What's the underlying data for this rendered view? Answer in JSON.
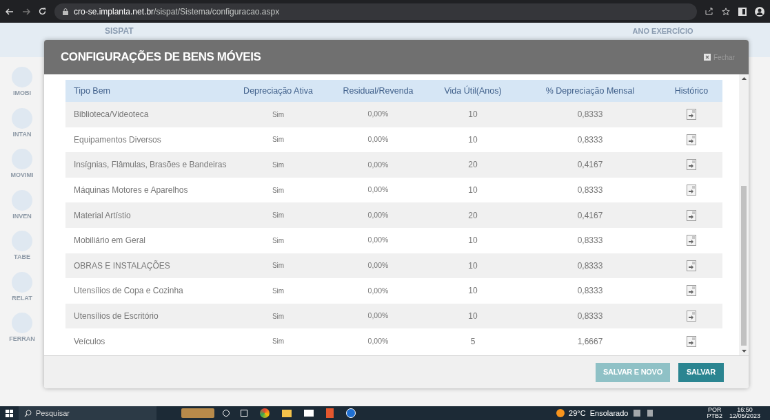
{
  "browser": {
    "url_host": "cro-se.implanta.net.br",
    "url_path": "/sispat/Sistema/configuracao.aspx"
  },
  "background": {
    "app_name": "SISPAT",
    "year_label": "ANO EXERCÍCIO",
    "sidebar": [
      "IMOBI",
      "INTAN",
      "MOVIMI",
      "INVEN",
      "TABE",
      "RELAT",
      "FERRAN"
    ]
  },
  "dialog": {
    "title": "CONFIGURAÇÕES DE BENS MÓVEIS",
    "close_label": "Fechar",
    "table": {
      "columns": [
        "Tipo Bem",
        "Depreciação Ativa",
        "Residual/Revenda",
        "Vida Útil(Anos)",
        "% Depreciação Mensal",
        "Histórico"
      ],
      "rows": [
        {
          "tipo": "Biblioteca/Videoteca",
          "ativa": "Sim",
          "residual": "0,00%",
          "vida": "10",
          "mensal": "0,8333"
        },
        {
          "tipo": "Equipamentos Diversos",
          "ativa": "Sim",
          "residual": "0,00%",
          "vida": "10",
          "mensal": "0,8333"
        },
        {
          "tipo": "Insígnias, Flâmulas, Brasões e Bandeiras",
          "ativa": "Sim",
          "residual": "0,00%",
          "vida": "20",
          "mensal": "0,4167"
        },
        {
          "tipo": "Máquinas Motores e Aparelhos",
          "ativa": "Sim",
          "residual": "0,00%",
          "vida": "10",
          "mensal": "0,8333"
        },
        {
          "tipo": "Material Artístio",
          "ativa": "Sim",
          "residual": "0,00%",
          "vida": "20",
          "mensal": "0,4167"
        },
        {
          "tipo": "Mobiliário em Geral",
          "ativa": "Sim",
          "residual": "0,00%",
          "vida": "10",
          "mensal": "0,8333"
        },
        {
          "tipo": "OBRAS E INSTALAÇÕES",
          "ativa": "Sim",
          "residual": "0,00%",
          "vida": "10",
          "mensal": "0,8333"
        },
        {
          "tipo": "Utensílios de Copa e Cozinha",
          "ativa": "Sim",
          "residual": "0,00%",
          "vida": "10",
          "mensal": "0,8333"
        },
        {
          "tipo": "Utensílios de Escritório",
          "ativa": "Sim",
          "residual": "0,00%",
          "vida": "10",
          "mensal": "0,8333"
        },
        {
          "tipo": "Veículos",
          "ativa": "Sim",
          "residual": "0,00%",
          "vida": "5",
          "mensal": "1,6667"
        }
      ]
    },
    "buttons": [
      "SALVAR E NOVO",
      "SALVAR"
    ]
  },
  "taskbar": {
    "search_placeholder": "Pesquisar",
    "weather": "29°C  Ensolarado",
    "language": "POR",
    "layout": "PTB2",
    "time": "16:50",
    "date": "12/05/2023"
  }
}
